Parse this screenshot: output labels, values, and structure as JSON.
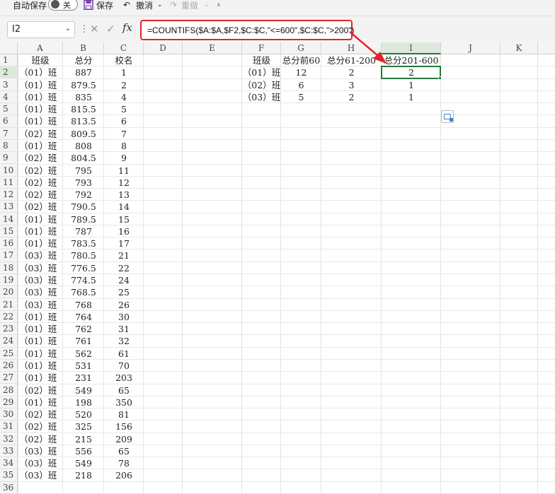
{
  "toolbar": {
    "autosave_label": "自动保存",
    "autosave_state": "关",
    "save_label": "保存",
    "undo_label": "撤消",
    "redo_label": "重做"
  },
  "formula_bar": {
    "name_box": "I2",
    "formula": "=COUNTIFS($A:$A,$F2,$C:$C,\"<=600\",$C:$C,\">200\")"
  },
  "columns": [
    "A",
    "B",
    "C",
    "D",
    "E",
    "F",
    "G",
    "H",
    "I",
    "J",
    "K"
  ],
  "selected_column": "I",
  "selected_row": 2,
  "row_count": 36,
  "data_headers": {
    "A": "班级",
    "B": "总分",
    "C": "校名"
  },
  "data_rows": [
    [
      "（01）班",
      "887",
      "1"
    ],
    [
      "（01）班",
      "879.5",
      "2"
    ],
    [
      "（01）班",
      "835",
      "4"
    ],
    [
      "（01）班",
      "815.5",
      "5"
    ],
    [
      "（01）班",
      "813.5",
      "6"
    ],
    [
      "（02）班",
      "809.5",
      "7"
    ],
    [
      "（01）班",
      "808",
      "8"
    ],
    [
      "（02）班",
      "804.5",
      "9"
    ],
    [
      "（02）班",
      "795",
      "11"
    ],
    [
      "（02）班",
      "793",
      "12"
    ],
    [
      "（02）班",
      "792",
      "13"
    ],
    [
      "（02）班",
      "790.5",
      "14"
    ],
    [
      "（01）班",
      "789.5",
      "15"
    ],
    [
      "（01）班",
      "787",
      "16"
    ],
    [
      "（01）班",
      "783.5",
      "17"
    ],
    [
      "（03）班",
      "780.5",
      "21"
    ],
    [
      "（03）班",
      "776.5",
      "22"
    ],
    [
      "（03）班",
      "774.5",
      "24"
    ],
    [
      "（03）班",
      "768.5",
      "25"
    ],
    [
      "（03）班",
      "768",
      "26"
    ],
    [
      "（01）班",
      "764",
      "30"
    ],
    [
      "（01）班",
      "762",
      "31"
    ],
    [
      "（01）班",
      "761",
      "32"
    ],
    [
      "（01）班",
      "562",
      "61"
    ],
    [
      "（01）班",
      "531",
      "70"
    ],
    [
      "（01）班",
      "231",
      "203"
    ],
    [
      "（02）班",
      "549",
      "65"
    ],
    [
      "（01）班",
      "198",
      "350"
    ],
    [
      "（02）班",
      "520",
      "81"
    ],
    [
      "（02）班",
      "325",
      "156"
    ],
    [
      "（02）班",
      "215",
      "209"
    ],
    [
      "（03）班",
      "556",
      "65"
    ],
    [
      "（03）班",
      "549",
      "78"
    ],
    [
      "（03）班",
      "218",
      "206"
    ]
  ],
  "summary_headers": {
    "F": "班级",
    "G": "总分前60",
    "H": "总分61-200",
    "I": "总分201-600"
  },
  "summary_rows": [
    [
      "（01）班",
      "12",
      "2",
      "2"
    ],
    [
      "（02）班",
      "6",
      "3",
      "1"
    ],
    [
      "（03）班",
      "5",
      "2",
      "1"
    ]
  ],
  "colors": {
    "accent": "#1e7a3c",
    "annotation": "#e0242b"
  }
}
